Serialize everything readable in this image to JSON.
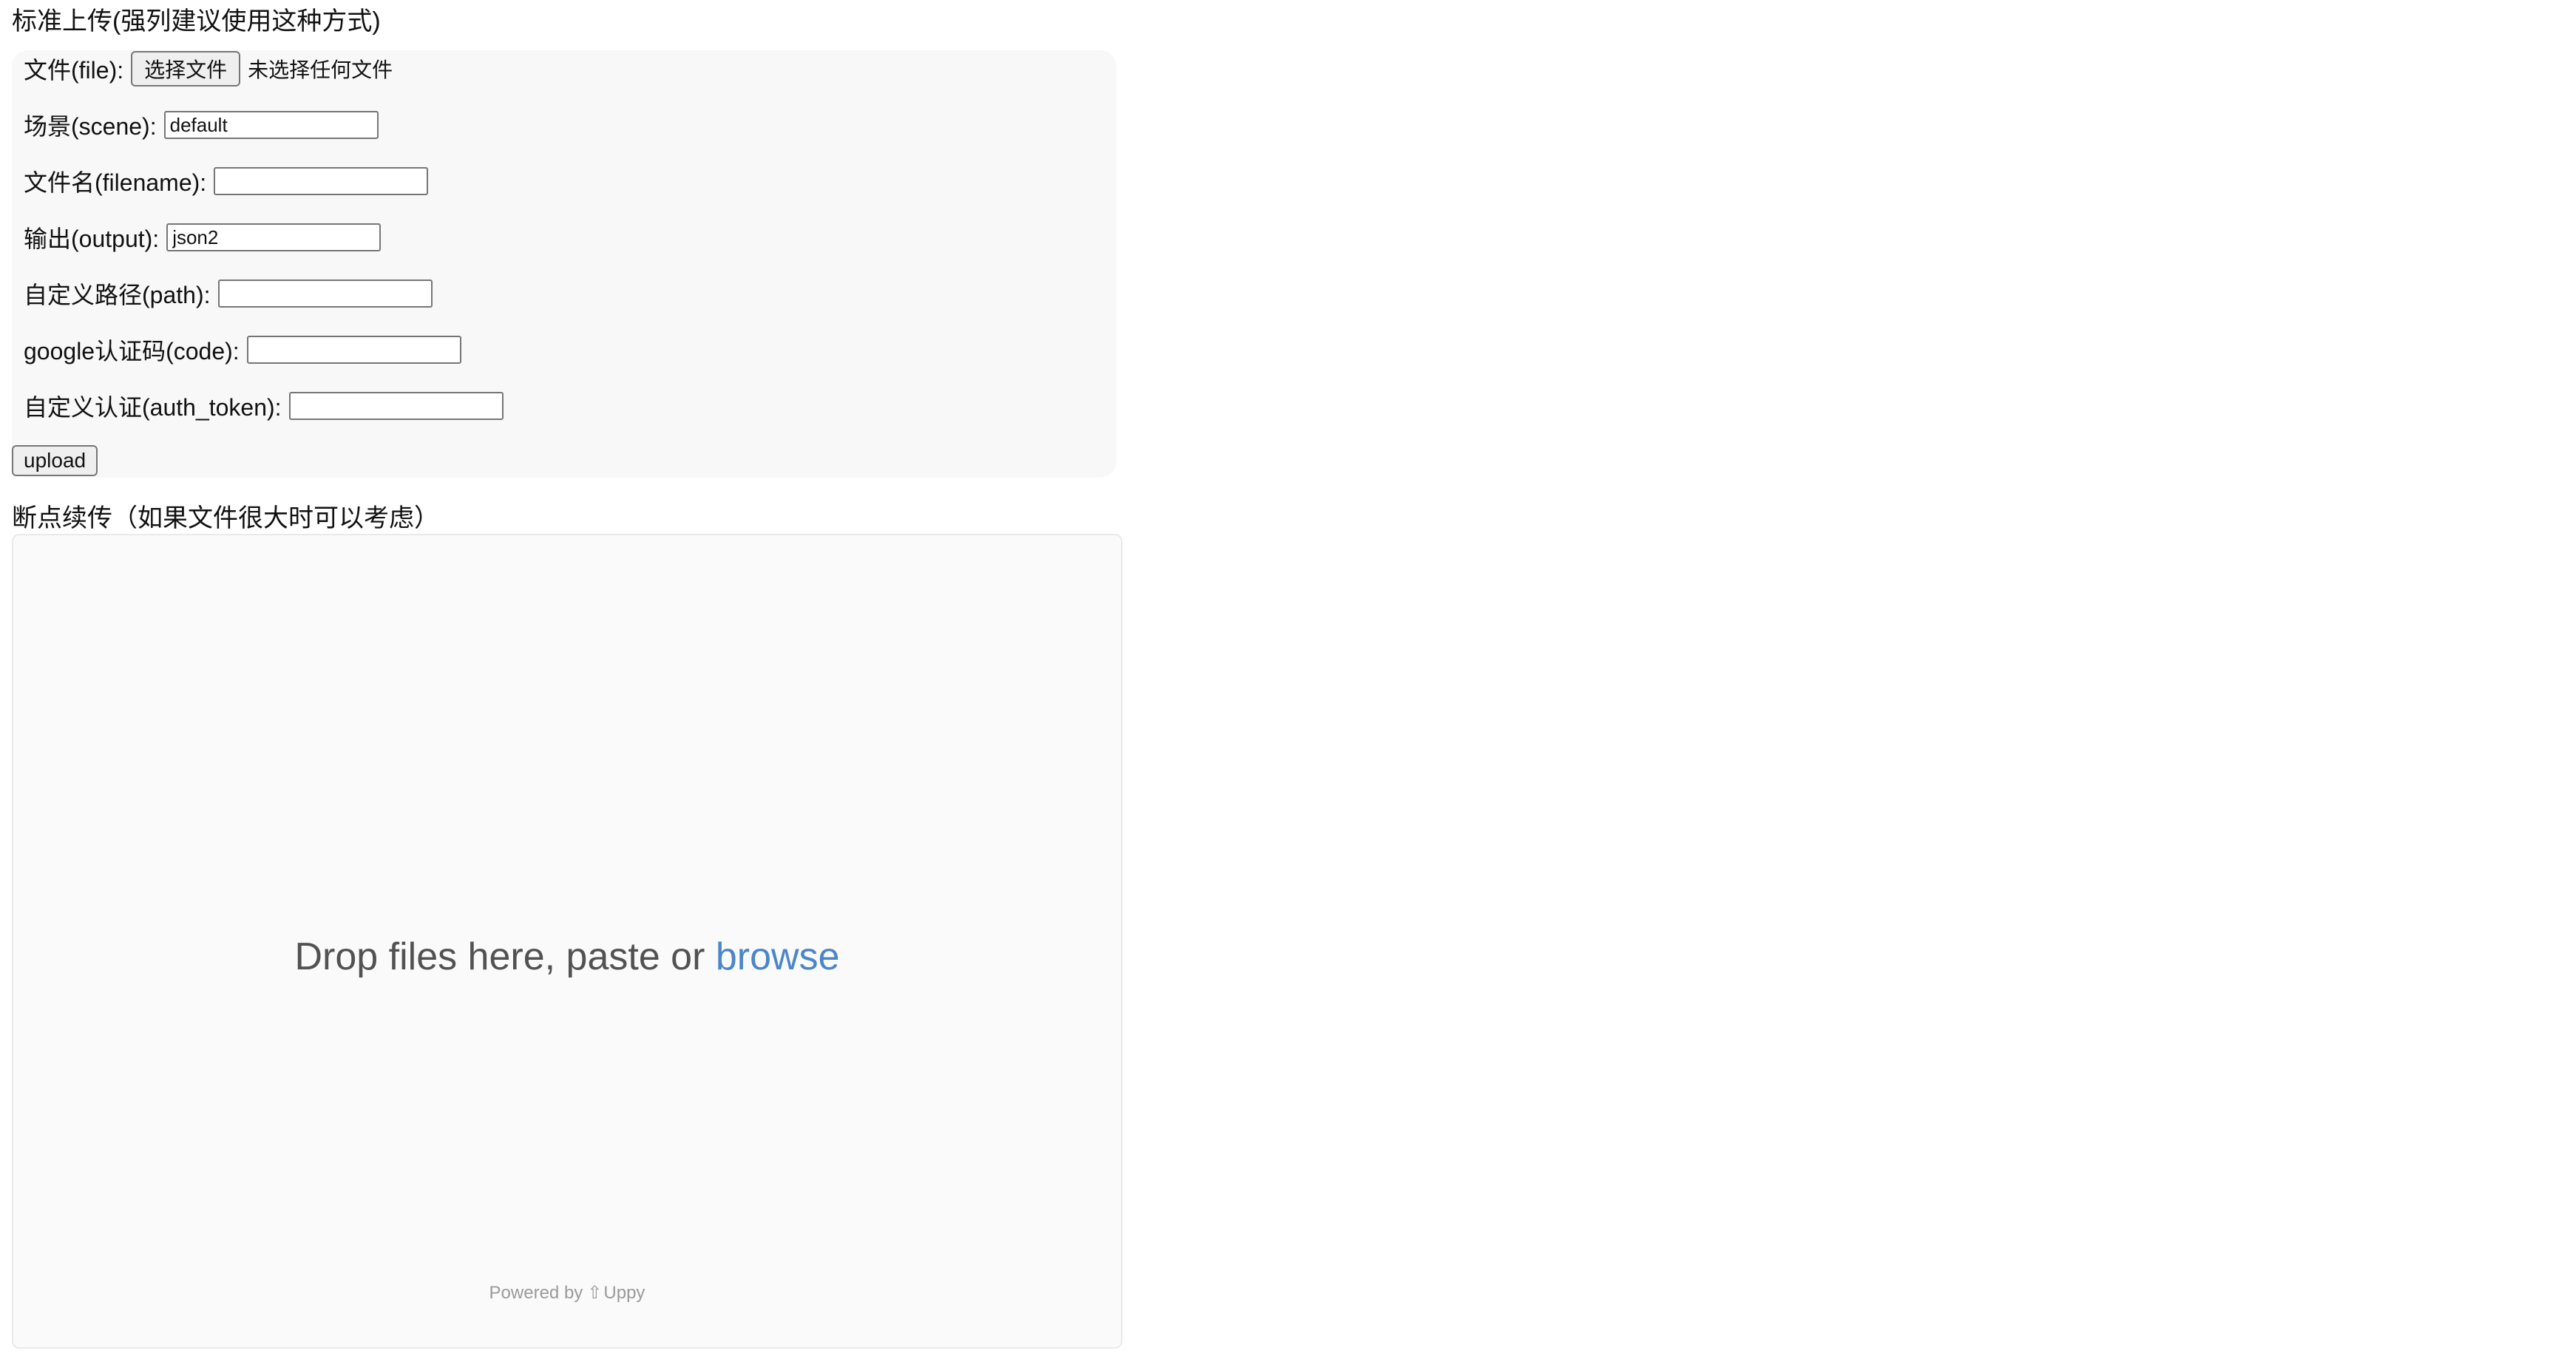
{
  "standard_upload": {
    "title": "标准上传(强列建议使用这种方式)",
    "file": {
      "label": "文件(file):",
      "button_label": "选择文件",
      "status": "未选择任何文件"
    },
    "scene": {
      "label": "场景(scene):",
      "value": "default"
    },
    "filename": {
      "label": "文件名(filename):",
      "value": ""
    },
    "output": {
      "label": "输出(output):",
      "value": "json2"
    },
    "path": {
      "label": "自定义路径(path):",
      "value": ""
    },
    "code": {
      "label": "google认证码(code):",
      "value": ""
    },
    "auth_token": {
      "label": "自定义认证(auth_token):",
      "value": ""
    },
    "upload_label": "upload"
  },
  "resumable_upload": {
    "title": "断点续传（如果文件很大时可以考虑）",
    "drop_text": "Drop files here, paste or ",
    "browse_label": "browse",
    "powered_by": "Powered by",
    "brand_icon": "uppy-logo-icon",
    "brand": "Uppy",
    "link_color": "#4a86c9"
  }
}
